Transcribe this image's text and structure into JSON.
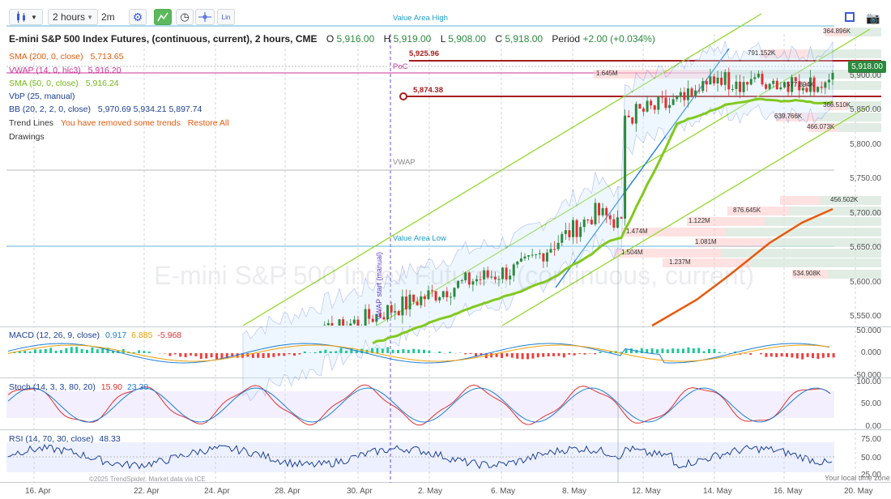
{
  "toolbar": {
    "chart_type_icon": "candlestick-icon",
    "interval": "2 hours",
    "alt_interval": "2m",
    "lin_label": "Lin"
  },
  "title": {
    "symbol": "E-mini S&P 500 Index Futures, (continuous, current), 2 hours, CME",
    "o_label": "O",
    "o": "5,916.00",
    "h_label": "H",
    "h": "5,919.00",
    "l_label": "L",
    "l": "5,908.00",
    "c_label": "C",
    "c": "5,918.00",
    "period_label": "Period",
    "period": "+2.00 (+0.034%)"
  },
  "legend": {
    "sma200_label": "SMA (200, 0, close)",
    "sma200_value": "5,713.65",
    "vwap_label": "VWAP (14, 0, hlc3)",
    "vwap_value": "5,916.20",
    "sma50_label": "SMA (50, 0, close)",
    "sma50_value": "5,916.24",
    "vbp_label": "VbP (25, manual)",
    "bb_label": "BB (20, 2, 2, 0, close)",
    "bb_values": "5,970.69 5,934.21 5,897.74",
    "trend_label": "Trend Lines",
    "trend_msg": "You have removed some trends",
    "restore": "Restore All",
    "drawings": "Drawings"
  },
  "annotations": {
    "value_area_high": "Value Area High",
    "value_area_low": "Value Area Low",
    "poc": "PoC",
    "vwap": "VWAP",
    "vwap_start": "VWAP start (manual)",
    "level1": "5,925.96",
    "level2": "5,874.38",
    "watermark": "E-mini S&P 500 Index Futures, (continuous, current)"
  },
  "vbp_labels": [
    "364.896K",
    "791.152K",
    "1.645M",
    "577.894K",
    "366.510K",
    "639.766K",
    "466.073K",
    "456.502K",
    "876.645K",
    "1.122M",
    "1.474M",
    "1.081M",
    "1.504M",
    "1.237M",
    "534.908K"
  ],
  "price_axis": {
    "current": "5,918.00",
    "ticks": [
      "5,900.00",
      "5,850.00",
      "5,800.00",
      "5,750.00",
      "5,700.00",
      "5,650.00",
      "5,600.00",
      "5,550.00"
    ]
  },
  "macd": {
    "label": "MACD (12, 26, 9, close)",
    "v1": "0.917",
    "v2": "6.885",
    "v3": "-5.968",
    "ticks": [
      "50.000",
      "0.000",
      "-50.000"
    ]
  },
  "stoch": {
    "label": "Stoch (14, 3, 3, 80, 20)",
    "v1": "15.90",
    "v2": "23.30",
    "ticks": [
      "100.00",
      "50.00",
      "0.00"
    ]
  },
  "rsi": {
    "label": "RSI (14, 70, 30, close)",
    "v1": "48.33",
    "ticks": [
      "75.00",
      "50.00",
      "25.00"
    ]
  },
  "x_axis": [
    "16. Apr",
    "22. Apr",
    "24. Apr",
    "28. Apr",
    "30. Apr",
    "2. May",
    "6. May",
    "8. May",
    "12. May",
    "14. May",
    "16. May",
    "20. May"
  ],
  "footer": {
    "credit": "©2025 TrendSpider. Market data via ICE",
    "tz": "Your local time zone"
  },
  "colors": {
    "up": "#2b8a3e",
    "down": "#e03131",
    "sma200": "#e8590c",
    "sma50": "#82c91e",
    "vwap": "#cc3399",
    "bb": "#3b5bdb",
    "trend": "#94d82d",
    "blue_line": "#1c7ed6",
    "level": "#a61e1e"
  }
}
